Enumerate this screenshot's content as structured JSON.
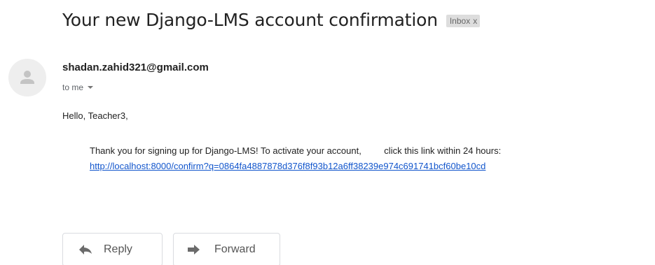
{
  "email": {
    "subject": "Your new Django-LMS account confirmation",
    "label": "Inbox",
    "label_close": "x",
    "sender": "shadan.zahid321@gmail.com",
    "recipient": "to me",
    "greeting": "Hello, Teacher3,",
    "body_line": "Thank you for signing up for Django-LMS! To activate your account,         click this link within 24 hours:",
    "link": "http://localhost:8000/confirm?q=0864fa4887878d376f8f93b12a6ff38239e974c691741bcf60be10cd"
  },
  "actions": {
    "reply_label": "Reply",
    "forward_label": "Forward"
  },
  "icons": {
    "avatar": "person-silhouette-icon",
    "reply": "reply-arrow-icon",
    "forward": "forward-arrow-icon",
    "recipient_toggle": "chevron-down-icon"
  },
  "colors": {
    "link": "#1155cc",
    "label_chip_bg": "#dddddd",
    "avatar_bg": "#eeeeee"
  }
}
